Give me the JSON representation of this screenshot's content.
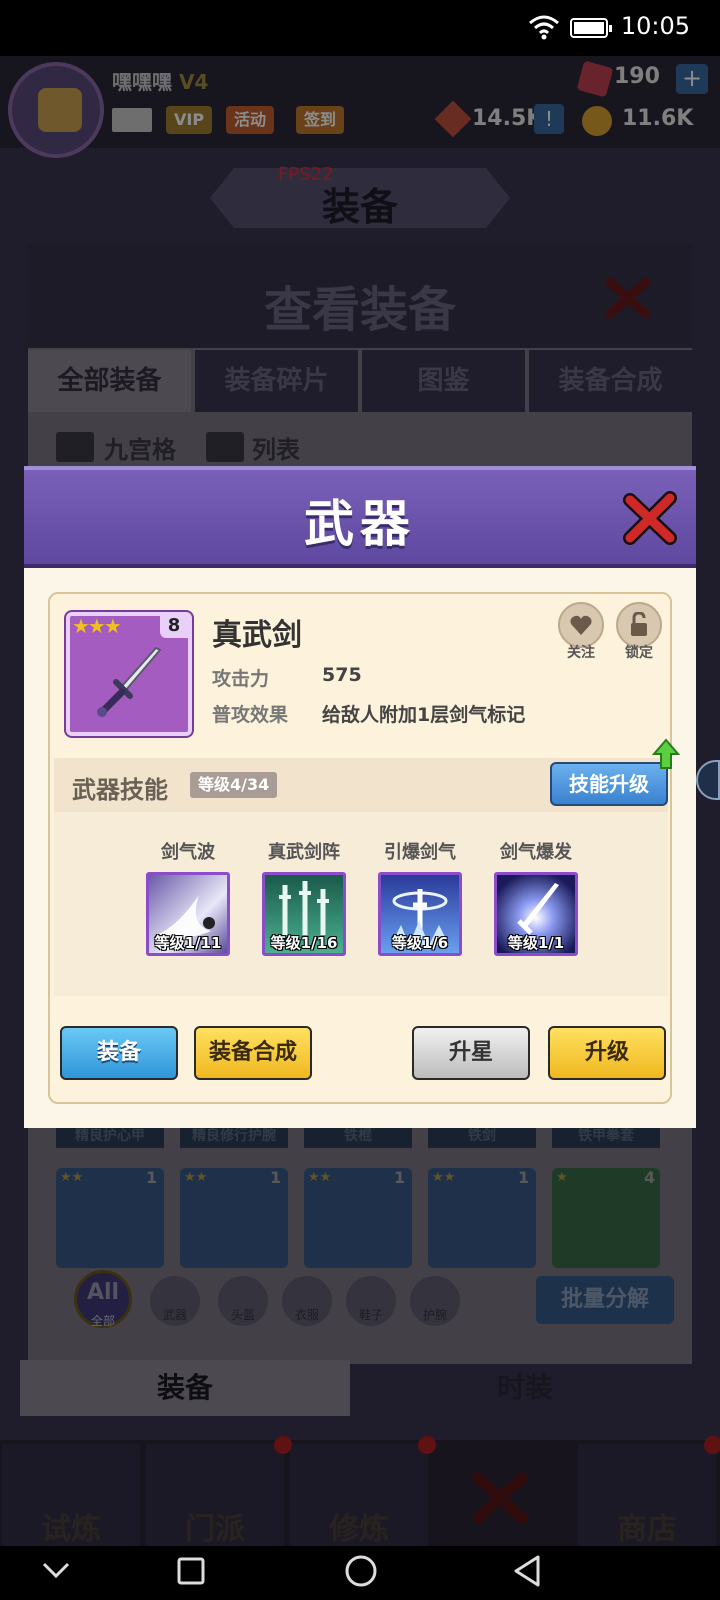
{
  "status": {
    "time": "10:05"
  },
  "player": {
    "name": "嘿嘿嘿",
    "vip_level": "V4",
    "tags": [
      "VIP",
      "活动",
      "签到"
    ]
  },
  "resources": {
    "gems": "190",
    "power": "14.5K",
    "gold": "11.6K"
  },
  "fps": "FPS22",
  "screen_title": "装备",
  "panel": {
    "title": "查看装备",
    "tabs": [
      "全部装备",
      "装备碎片",
      "图鉴",
      "装备合成"
    ],
    "view_modes": [
      "九宫格",
      "列表"
    ]
  },
  "inventory": {
    "row_names": [
      "精良护心甲",
      "精良修行护腕",
      "铁棍",
      "铁剑",
      "铁甲拳套"
    ],
    "cards": [
      {
        "stars": "★★",
        "count": "1"
      },
      {
        "stars": "★★",
        "count": "1"
      },
      {
        "stars": "★★",
        "count": "1"
      },
      {
        "stars": "★★",
        "count": "1"
      },
      {
        "stars": "★",
        "count": "4"
      }
    ]
  },
  "filters": {
    "all": "All",
    "all_sub": "全部",
    "items": [
      "武器",
      "头盔",
      "衣服",
      "鞋子",
      "护腕"
    ]
  },
  "batch_button": "批量分解",
  "subtabs": [
    "装备",
    "时装"
  ],
  "navbar": [
    "试炼",
    "门派",
    "修炼",
    "",
    "商店"
  ],
  "modal": {
    "title": "武器",
    "weapon": {
      "name": "真武剑",
      "stars": "★★★",
      "level": "8",
      "attack_label": "攻击力",
      "attack_value": "575",
      "effect_label": "普攻效果",
      "effect_value": "给敌人附加1层剑气标记"
    },
    "follow_label": "关注",
    "lock_label": "锁定",
    "skill_section": {
      "title": "武器技能",
      "level": "等级4/34",
      "upgrade_button": "技能升级",
      "skills": [
        {
          "name": "剑气波",
          "level": "等级1/11"
        },
        {
          "name": "真武剑阵",
          "level": "等级1/16"
        },
        {
          "name": "引爆剑气",
          "level": "等级1/6"
        },
        {
          "name": "剑气爆发",
          "level": "等级1/1"
        }
      ]
    },
    "buttons": {
      "equip": "装备",
      "combine": "装备合成",
      "star_up": "升星",
      "upgrade": "升级"
    }
  },
  "colors": {
    "modal_header": "#6a52ac",
    "blue_button": "#3a9be0",
    "yellow_button": "#f6c830",
    "skill_frame": "#8a4cc8"
  }
}
